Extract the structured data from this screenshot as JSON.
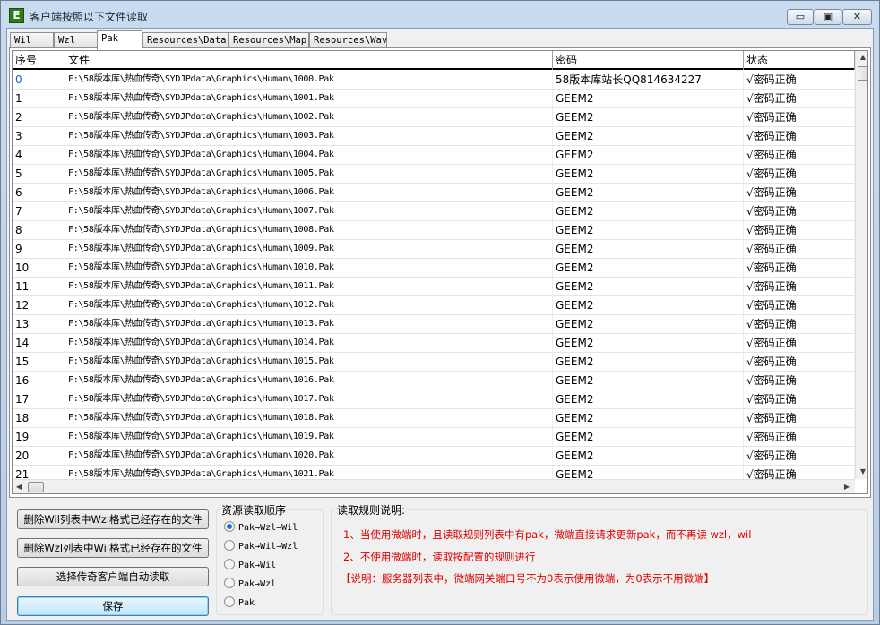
{
  "window": {
    "title": "客户端按照以下文件读取",
    "icon_letter": "E",
    "minimize_glyph": "▭",
    "maximize_glyph": "▣",
    "close_glyph": "✕"
  },
  "tabs": [
    {
      "label": "Wil",
      "active": false
    },
    {
      "label": "Wzl",
      "active": false
    },
    {
      "label": "Pak",
      "active": true
    },
    {
      "label": "Resources\\Data",
      "active": false
    },
    {
      "label": "Resources\\Map",
      "active": false
    },
    {
      "label": "Resources\\Wav",
      "active": false
    }
  ],
  "grid": {
    "columns": [
      "序号",
      "文件",
      "密码",
      "状态"
    ],
    "rows": [
      {
        "index": "0",
        "file": "F:\\58版本库\\热血传奇\\SYDJPdata\\Graphics\\Human\\1000.Pak",
        "password": "58版本库站长QQ814634227",
        "status": "√密码正确"
      },
      {
        "index": "1",
        "file": "F:\\58版本库\\热血传奇\\SYDJPdata\\Graphics\\Human\\1001.Pak",
        "password": "GEEM2",
        "status": "√密码正确"
      },
      {
        "index": "2",
        "file": "F:\\58版本库\\热血传奇\\SYDJPdata\\Graphics\\Human\\1002.Pak",
        "password": "GEEM2",
        "status": "√密码正确"
      },
      {
        "index": "3",
        "file": "F:\\58版本库\\热血传奇\\SYDJPdata\\Graphics\\Human\\1003.Pak",
        "password": "GEEM2",
        "status": "√密码正确"
      },
      {
        "index": "4",
        "file": "F:\\58版本库\\热血传奇\\SYDJPdata\\Graphics\\Human\\1004.Pak",
        "password": "GEEM2",
        "status": "√密码正确"
      },
      {
        "index": "5",
        "file": "F:\\58版本库\\热血传奇\\SYDJPdata\\Graphics\\Human\\1005.Pak",
        "password": "GEEM2",
        "status": "√密码正确"
      },
      {
        "index": "6",
        "file": "F:\\58版本库\\热血传奇\\SYDJPdata\\Graphics\\Human\\1006.Pak",
        "password": "GEEM2",
        "status": "√密码正确"
      },
      {
        "index": "7",
        "file": "F:\\58版本库\\热血传奇\\SYDJPdata\\Graphics\\Human\\1007.Pak",
        "password": "GEEM2",
        "status": "√密码正确"
      },
      {
        "index": "8",
        "file": "F:\\58版本库\\热血传奇\\SYDJPdata\\Graphics\\Human\\1008.Pak",
        "password": "GEEM2",
        "status": "√密码正确"
      },
      {
        "index": "9",
        "file": "F:\\58版本库\\热血传奇\\SYDJPdata\\Graphics\\Human\\1009.Pak",
        "password": "GEEM2",
        "status": "√密码正确"
      },
      {
        "index": "10",
        "file": "F:\\58版本库\\热血传奇\\SYDJPdata\\Graphics\\Human\\1010.Pak",
        "password": "GEEM2",
        "status": "√密码正确"
      },
      {
        "index": "11",
        "file": "F:\\58版本库\\热血传奇\\SYDJPdata\\Graphics\\Human\\1011.Pak",
        "password": "GEEM2",
        "status": "√密码正确"
      },
      {
        "index": "12",
        "file": "F:\\58版本库\\热血传奇\\SYDJPdata\\Graphics\\Human\\1012.Pak",
        "password": "GEEM2",
        "status": "√密码正确"
      },
      {
        "index": "13",
        "file": "F:\\58版本库\\热血传奇\\SYDJPdata\\Graphics\\Human\\1013.Pak",
        "password": "GEEM2",
        "status": "√密码正确"
      },
      {
        "index": "14",
        "file": "F:\\58版本库\\热血传奇\\SYDJPdata\\Graphics\\Human\\1014.Pak",
        "password": "GEEM2",
        "status": "√密码正确"
      },
      {
        "index": "15",
        "file": "F:\\58版本库\\热血传奇\\SYDJPdata\\Graphics\\Human\\1015.Pak",
        "password": "GEEM2",
        "status": "√密码正确"
      },
      {
        "index": "16",
        "file": "F:\\58版本库\\热血传奇\\SYDJPdata\\Graphics\\Human\\1016.Pak",
        "password": "GEEM2",
        "status": "√密码正确"
      },
      {
        "index": "17",
        "file": "F:\\58版本库\\热血传奇\\SYDJPdata\\Graphics\\Human\\1017.Pak",
        "password": "GEEM2",
        "status": "√密码正确"
      },
      {
        "index": "18",
        "file": "F:\\58版本库\\热血传奇\\SYDJPdata\\Graphics\\Human\\1018.Pak",
        "password": "GEEM2",
        "status": "√密码正确"
      },
      {
        "index": "19",
        "file": "F:\\58版本库\\热血传奇\\SYDJPdata\\Graphics\\Human\\1019.Pak",
        "password": "GEEM2",
        "status": "√密码正确"
      },
      {
        "index": "20",
        "file": "F:\\58版本库\\热血传奇\\SYDJPdata\\Graphics\\Human\\1020.Pak",
        "password": "GEEM2",
        "status": "√密码正确"
      },
      {
        "index": "21",
        "file": "F:\\58版本库\\热血传奇\\SYDJPdata\\Graphics\\Human\\1021.Pak",
        "password": "GEEM2",
        "status": "√密码正确"
      }
    ],
    "scroll_up_glyph": "▲",
    "scroll_down_glyph": "▼",
    "scroll_left_glyph": "◀",
    "scroll_right_glyph": "▶"
  },
  "buttons": {
    "delete_wil": "删除Wil列表中Wzl格式已经存在的文件",
    "delete_wzl": "删除Wzl列表中Wil格式已经存在的文件",
    "auto_read": "选择传奇客户端自动读取",
    "save": "保存"
  },
  "read_order": {
    "title": "资源读取顺序",
    "options": [
      {
        "label": "Pak→Wzl→Wil",
        "checked": true
      },
      {
        "label": "Pak→Wil→Wzl",
        "checked": false
      },
      {
        "label": "Pak→Wil",
        "checked": false
      },
      {
        "label": "Pak→Wzl",
        "checked": false
      },
      {
        "label": "Pak",
        "checked": false
      }
    ]
  },
  "rules": {
    "title": "读取规则说明:",
    "lines": [
      "1、当使用微端时，且读取规则列表中有pak，微端直接请求更新pak，而不再读 wzl，wil",
      "2、不使用微端时，读取按配置的规则进行",
      "【说明：服务器列表中，微端网关端口号不为0表示使用微端，为0表示不用微端】"
    ],
    "color": "#e00000"
  }
}
